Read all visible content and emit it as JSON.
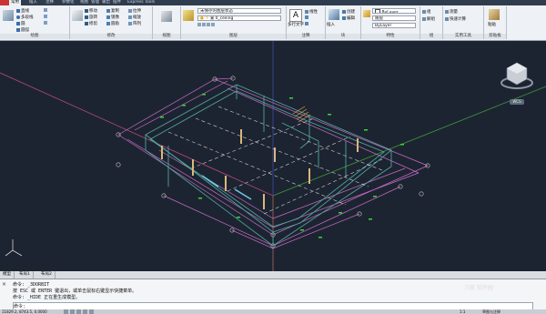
{
  "ribbon": {
    "tabs": [
      "",
      "常用",
      "插入",
      "注释",
      "参数化",
      "视图",
      "管理",
      "输出",
      "插件",
      "Express Tools"
    ],
    "panels": {
      "draw": {
        "title": "绘图",
        "items": [
          "直线",
          "多段线",
          "圆",
          "圆弧"
        ]
      },
      "modify": {
        "title": "修改",
        "items": [
          "移动",
          "旋转",
          "修剪",
          "复制",
          "镜像",
          "圆角",
          "拉伸",
          "缩放",
          "阵列"
        ]
      },
      "view": {
        "title": "视图"
      },
      "layers": {
        "title": "图层",
        "current_layer": "未保存的图层状态",
        "layer_name": "0_ceiling"
      },
      "annotation": {
        "title": "注释",
        "big_label": "多行文字",
        "dim_label": "线性"
      },
      "block": {
        "title": "块",
        "insert": "插入",
        "create": "创建",
        "edit": "编辑"
      },
      "properties": {
        "title": "特性",
        "color": "ByLayer",
        "linetype": "ByLayer",
        "lineweight": "随层"
      },
      "groups": {
        "title": "组",
        "items": [
          "组",
          "解组"
        ]
      },
      "utilities": {
        "title": "实用工具",
        "items": [
          "测量",
          "快速计算"
        ]
      },
      "clipboard": {
        "title": "剪贴板",
        "items": [
          "粘贴"
        ]
      }
    }
  },
  "viewport": {
    "viewcube_label": "上",
    "wcs_label": "WCS"
  },
  "model_tabs": [
    "模型",
    "布局1",
    "布局2"
  ],
  "command": {
    "line1": "命令: _3DORBIT",
    "line2": "按 ESC 或 ENTER 键退出，或单击鼠标右键显示快捷菜单。",
    "line3": "命令: _HIDE 正在重生成模型。",
    "prompt": "命令:"
  },
  "status_bar": {
    "coords": "11829.2, 8743.5, 0.0000",
    "annotation_scale": "1:1",
    "workspace": "草图与注释"
  },
  "watermark": "三联 软件园"
}
